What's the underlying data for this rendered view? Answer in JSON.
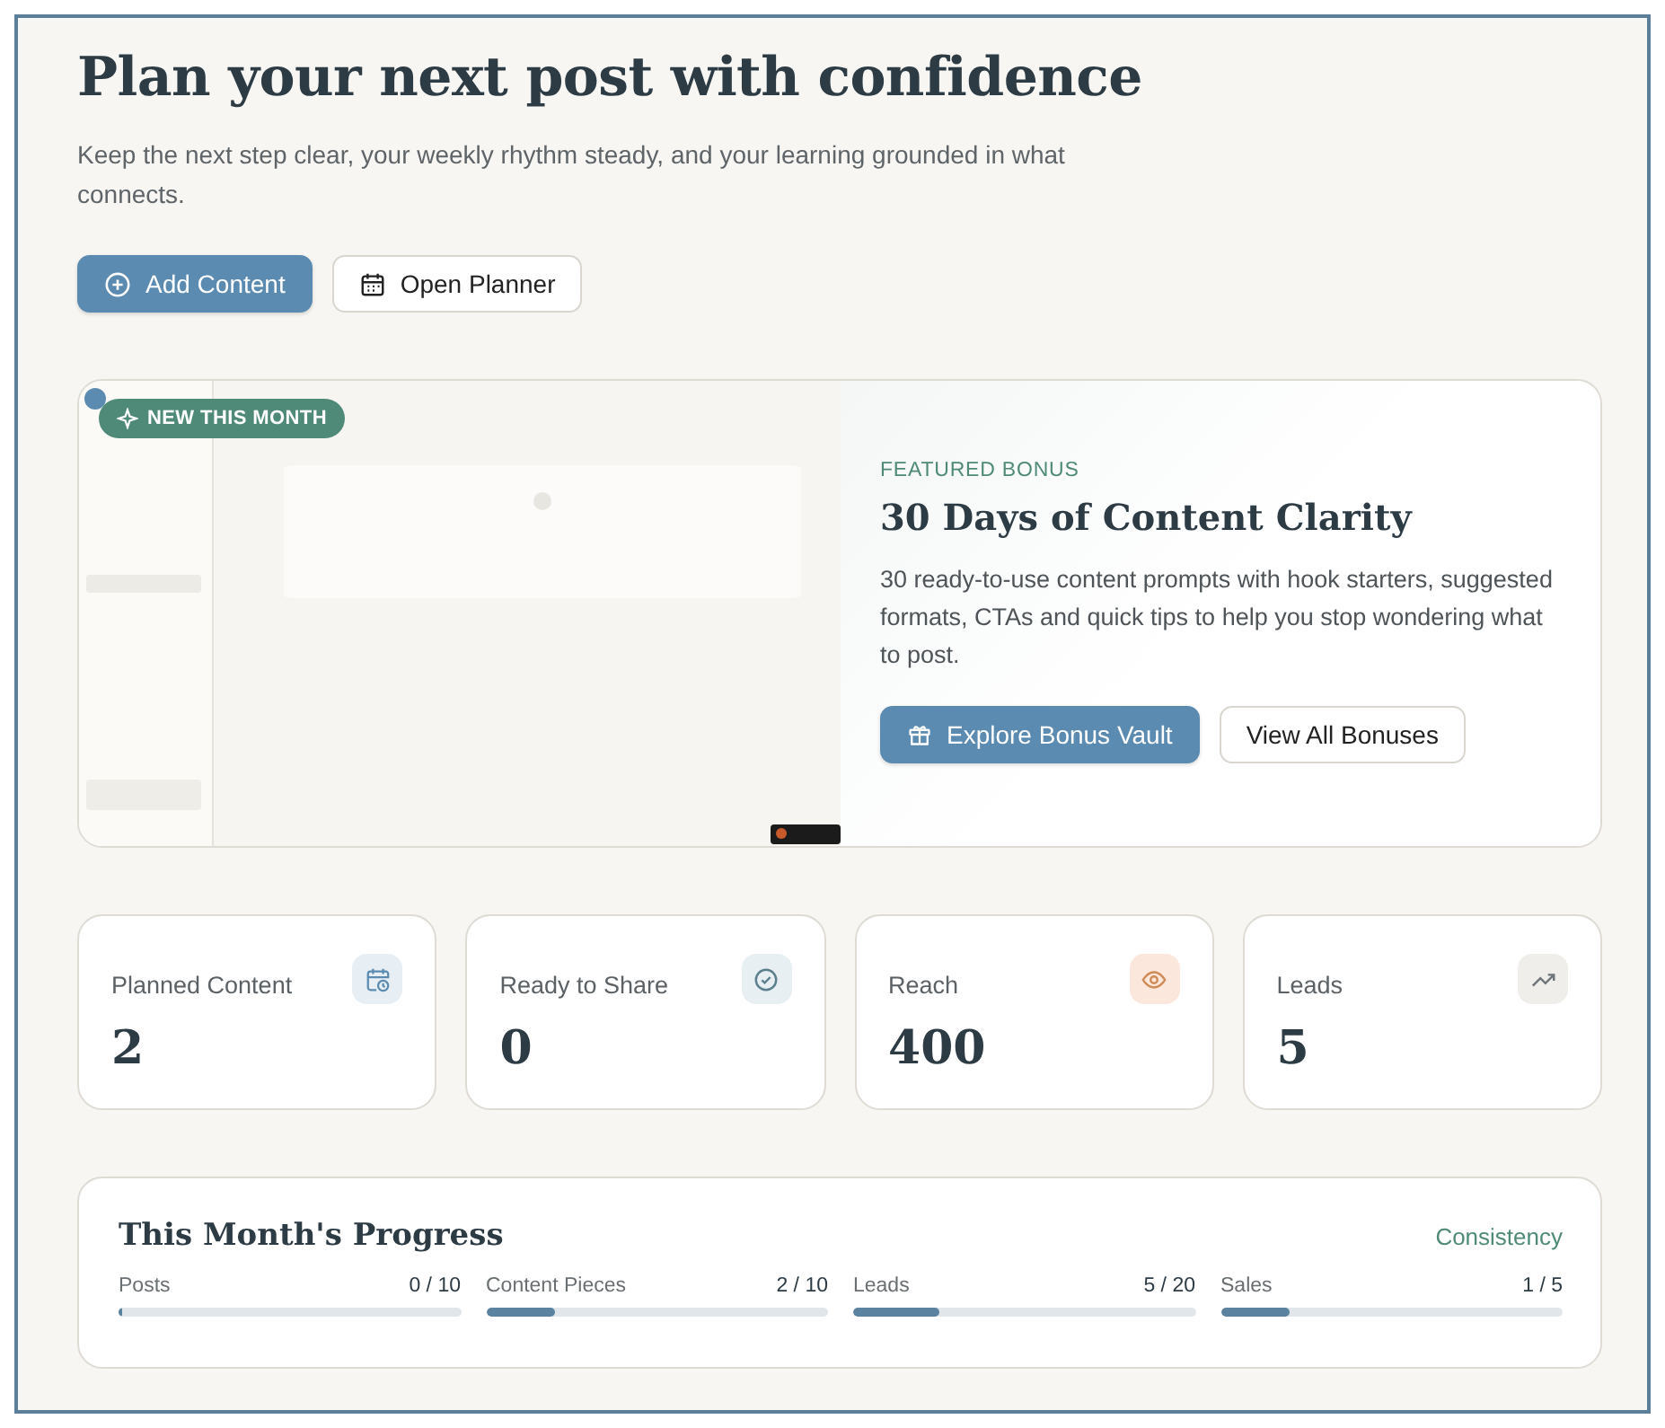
{
  "header": {
    "title": "Plan your next post with confidence",
    "subtitle": "Keep the next step clear, your weekly rhythm steady, and your learning grounded in what connects."
  },
  "actions": [
    {
      "label": "Add Content",
      "kind": "primary"
    },
    {
      "label": "Open Planner",
      "kind": "secondary"
    }
  ],
  "featured": {
    "badge": "NEW THIS MONTH",
    "eyebrow": "FEATURED BONUS",
    "title": "30 Days of Content Clarity",
    "description": "30 ready-to-use content prompts with hook starters, suggested formats, CTAs and quick tips to help you stop wondering what to post.",
    "buttons": [
      {
        "label": "Explore Bonus Vault",
        "kind": "primary"
      },
      {
        "label": "View All Bonuses",
        "kind": "secondary"
      }
    ]
  },
  "stats": [
    {
      "label": "Planned Content",
      "value": "2",
      "kind": "calendar"
    },
    {
      "label": "Ready to Share",
      "value": "0",
      "kind": "check"
    },
    {
      "label": "Reach",
      "value": "400",
      "kind": "eye"
    },
    {
      "label": "Leads",
      "value": "5",
      "kind": "trend"
    }
  ],
  "progress": {
    "title": "This Month's Progress",
    "link": "Consistency",
    "items": [
      {
        "label": "Posts",
        "reading": "0 / 10",
        "level": 0.0
      },
      {
        "label": "Content Pieces",
        "reading": "2 / 10",
        "level": 0.2
      },
      {
        "label": "Leads",
        "reading": "5 / 20",
        "level": 0.25
      },
      {
        "label": "Sales",
        "reading": "1 / 5",
        "level": 0.2
      }
    ]
  }
}
